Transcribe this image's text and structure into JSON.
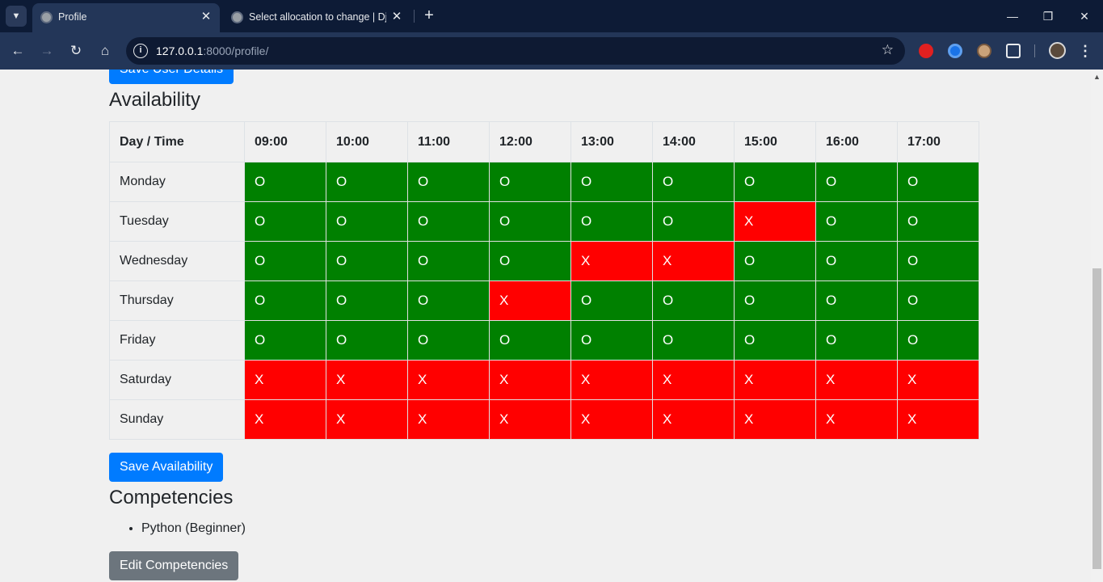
{
  "browser": {
    "tabs": [
      {
        "title": "Profile",
        "active": true
      },
      {
        "title": "Select allocation to change | Dj",
        "active": false
      }
    ],
    "url_host": "127.0.0.1",
    "url_path": ":8000/profile/",
    "icons": {
      "tab_menu": "chevron-down-icon",
      "back": "←",
      "forward": "→",
      "reload": "↻",
      "home": "⌂",
      "star": "☆",
      "new_tab": "+",
      "minimize": "—",
      "restore": "❐",
      "close": "✕",
      "menu": "⋮"
    }
  },
  "page": {
    "save_user_details_label": "Save User Details",
    "availability_heading": "Availability",
    "table": {
      "corner_header": "Day / Time",
      "times": [
        "09:00",
        "10:00",
        "11:00",
        "12:00",
        "13:00",
        "14:00",
        "15:00",
        "16:00",
        "17:00"
      ],
      "rows": [
        {
          "day": "Monday",
          "slots": [
            "O",
            "O",
            "O",
            "O",
            "O",
            "O",
            "O",
            "O",
            "O"
          ]
        },
        {
          "day": "Tuesday",
          "slots": [
            "O",
            "O",
            "O",
            "O",
            "O",
            "O",
            "X",
            "O",
            "O"
          ]
        },
        {
          "day": "Wednesday",
          "slots": [
            "O",
            "O",
            "O",
            "O",
            "X",
            "X",
            "O",
            "O",
            "O"
          ]
        },
        {
          "day": "Thursday",
          "slots": [
            "O",
            "O",
            "O",
            "X",
            "O",
            "O",
            "O",
            "O",
            "O"
          ]
        },
        {
          "day": "Friday",
          "slots": [
            "O",
            "O",
            "O",
            "O",
            "O",
            "O",
            "O",
            "O",
            "O"
          ]
        },
        {
          "day": "Saturday",
          "slots": [
            "X",
            "X",
            "X",
            "X",
            "X",
            "X",
            "X",
            "X",
            "X"
          ]
        },
        {
          "day": "Sunday",
          "slots": [
            "X",
            "X",
            "X",
            "X",
            "X",
            "X",
            "X",
            "X",
            "X"
          ]
        }
      ],
      "colors": {
        "available": "#008000",
        "unavailable": "#ff0000"
      }
    },
    "save_availability_label": "Save Availability",
    "competencies_heading": "Competencies",
    "competencies": [
      "Python (Beginner)"
    ],
    "edit_competencies_label": "Edit Competencies"
  }
}
